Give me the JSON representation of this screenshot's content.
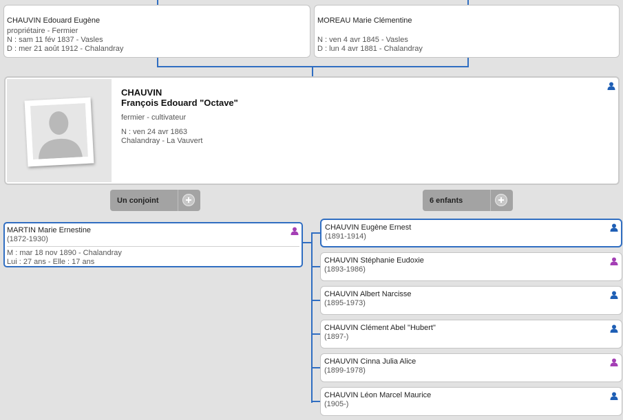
{
  "father": {
    "name": "CHAUVIN Edouard Eugène",
    "occupation": "propriétaire - Fermier",
    "birth": "N : sam 11 fév 1837 - Vasles",
    "death": "D : mer 21 août 1912 - Chalandray"
  },
  "mother": {
    "name": "MOREAU Marie Clémentine",
    "birth": "N : ven 4 avr 1845 - Vasles",
    "death": "D : lun 4 avr 1881 - Chalandray"
  },
  "main": {
    "surname": "CHAUVIN",
    "given": "François Edouard \"Octave\"",
    "occupation": "fermier - cultivateur",
    "birth": "N : ven 24 avr 1863",
    "place": "Chalandray - La Vauvert"
  },
  "spouses_button": {
    "label": "Un conjoint"
  },
  "children_button": {
    "label": "6 enfants"
  },
  "spouse": {
    "name": "MARTIN Marie Ernestine",
    "dates": "(1872-1930)",
    "marriage": "M : mar 18 nov 1890 - Chalandray",
    "ages": "Lui : 27 ans - Elle : 17 ans"
  },
  "children": [
    {
      "name": "CHAUVIN Eugène Ernest",
      "dates": "(1891-1914)",
      "sex": "male"
    },
    {
      "name": "CHAUVIN Stéphanie Eudoxie",
      "dates": "(1893-1986)",
      "sex": "female"
    },
    {
      "name": "CHAUVIN Albert Narcisse",
      "dates": "(1895-1973)",
      "sex": "male"
    },
    {
      "name": "CHAUVIN Clément Abel \"Hubert\"",
      "dates": "(1897-)",
      "sex": "male"
    },
    {
      "name": "CHAUVIN Cinna Julia Alice",
      "dates": "(1899-1978)",
      "sex": "female"
    },
    {
      "name": "CHAUVIN Léon Marcel Maurice",
      "dates": "(1905-)",
      "sex": "male"
    }
  ],
  "colors": {
    "male": "#1f5fb5",
    "female": "#a43fb5",
    "connector": "#2f6dc1"
  }
}
